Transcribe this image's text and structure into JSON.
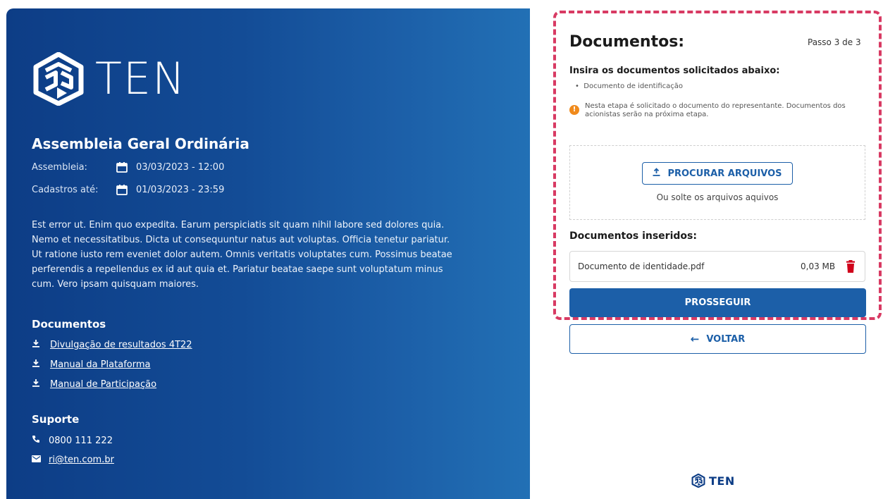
{
  "brand": {
    "name": "TEN"
  },
  "event": {
    "title": "Assembleia Geral Ordinária",
    "assembly_label": "Assembleia:",
    "assembly_date": "03/03/2023 - 12:00",
    "registration_label": "Cadastros até:",
    "registration_date": "01/03/2023 - 23:59",
    "description": "Est error ut. Enim quo expedita. Earum perspiciatis sit quam nihil labore sed dolores quia. Nemo et necessitatibus. Dicta ut consequuntur natus aut voluptas. Officia tenetur pariatur. Ut ratione iusto rem eveniet dolor autem. Omnis veritatis voluptates cum. Possimus beatae perferendis a repellendus ex id aut quia et. Pariatur beatae saepe sunt voluptatum minus cum. Vero ipsam quisquam maiores."
  },
  "documents": {
    "title": "Documentos",
    "links": [
      {
        "label": "Divulgação de resultados 4T22"
      },
      {
        "label": "Manual da Plataforma"
      },
      {
        "label": "Manual de Participação"
      }
    ]
  },
  "support": {
    "title": "Suporte",
    "phone": "0800 111 222",
    "email": "ri@ten.com.br"
  },
  "form": {
    "title": "Documentos:",
    "step": "Passo 3 de 3",
    "instruction": "Insira os documentos solicitados abaixo:",
    "required_doc": "Documento de identificação",
    "notice": "Nesta etapa é solicitado o documento do representante. Documentos dos acionistas serão na próxima etapa.",
    "browse_label": "PROCURAR ARQUIVOS",
    "drop_hint": "Ou solte os arquivos aquivos",
    "inserted_title": "Documentos inseridos:",
    "files": [
      {
        "name": "Documento de identidade.pdf",
        "size": "0,03 MB"
      }
    ],
    "continue_label": "PROSSEGUIR",
    "back_label": "VOLTAR"
  },
  "colors": {
    "primary": "#1c5fa8",
    "panel_dark": "#0d3d86",
    "highlight_border": "#d83a63",
    "warning": "#f08a1c",
    "delete": "#d0021b"
  }
}
